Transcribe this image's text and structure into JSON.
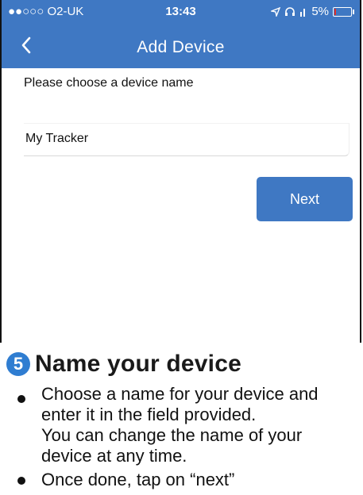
{
  "status_bar": {
    "carrier": "●●○○○ O2-UK",
    "time": "13:43",
    "battery": "5%"
  },
  "nav": {
    "title": "Add Device"
  },
  "form": {
    "prompt": "Please choose a device name",
    "device_name_value": "My Tracker",
    "next_label": "Next"
  },
  "instructions": {
    "step_number": "5",
    "title": "Name your device",
    "bullets": [
      {
        "lines": [
          "Choose a name for your device and",
          "enter it in the field provided.",
          "You can change the name of your",
          "device at any time."
        ]
      },
      {
        "lines": [
          "Once done, tap on “next”"
        ]
      }
    ]
  },
  "colors": {
    "app_bar": "#3f78c3",
    "step_badge": "#2f7dd1"
  }
}
